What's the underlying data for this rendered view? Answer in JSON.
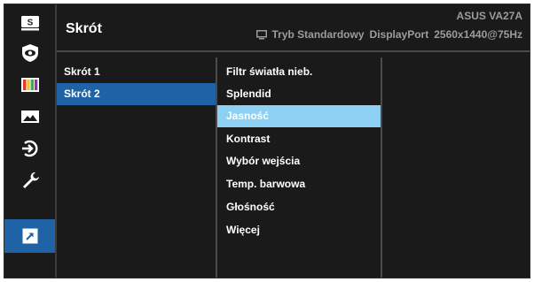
{
  "header": {
    "title": "Skrót",
    "model": "ASUS  VA27A",
    "mode": "Tryb Standardowy",
    "input": "DisplayPort",
    "resolution": "2560x1440@75Hz"
  },
  "sidebar": {
    "icons": [
      {
        "name": "splendid-icon",
        "label": "S"
      },
      {
        "name": "blue-light-filter-icon"
      },
      {
        "name": "color-icon"
      },
      {
        "name": "image-icon"
      },
      {
        "name": "input-select-icon"
      },
      {
        "name": "system-setup-icon"
      },
      {
        "name": "shortcut-icon",
        "active": true
      }
    ]
  },
  "menu": {
    "items": [
      {
        "label": "Skrót 1"
      },
      {
        "label": "Skrót 2",
        "selected": true
      }
    ]
  },
  "submenu": {
    "items": [
      {
        "label": "Filtr światła nieb."
      },
      {
        "label": "Splendid"
      },
      {
        "label": "Jasność",
        "highlighted": true
      },
      {
        "label": "Kontrast"
      },
      {
        "label": "Wybór wejścia"
      },
      {
        "label": "Temp. barwowa"
      },
      {
        "label": "Głośność"
      },
      {
        "label": "Więcej"
      }
    ]
  },
  "colors": {
    "selection": "#1f62a6",
    "highlight": "#8ed0f4",
    "background": "#1a1a1a"
  }
}
